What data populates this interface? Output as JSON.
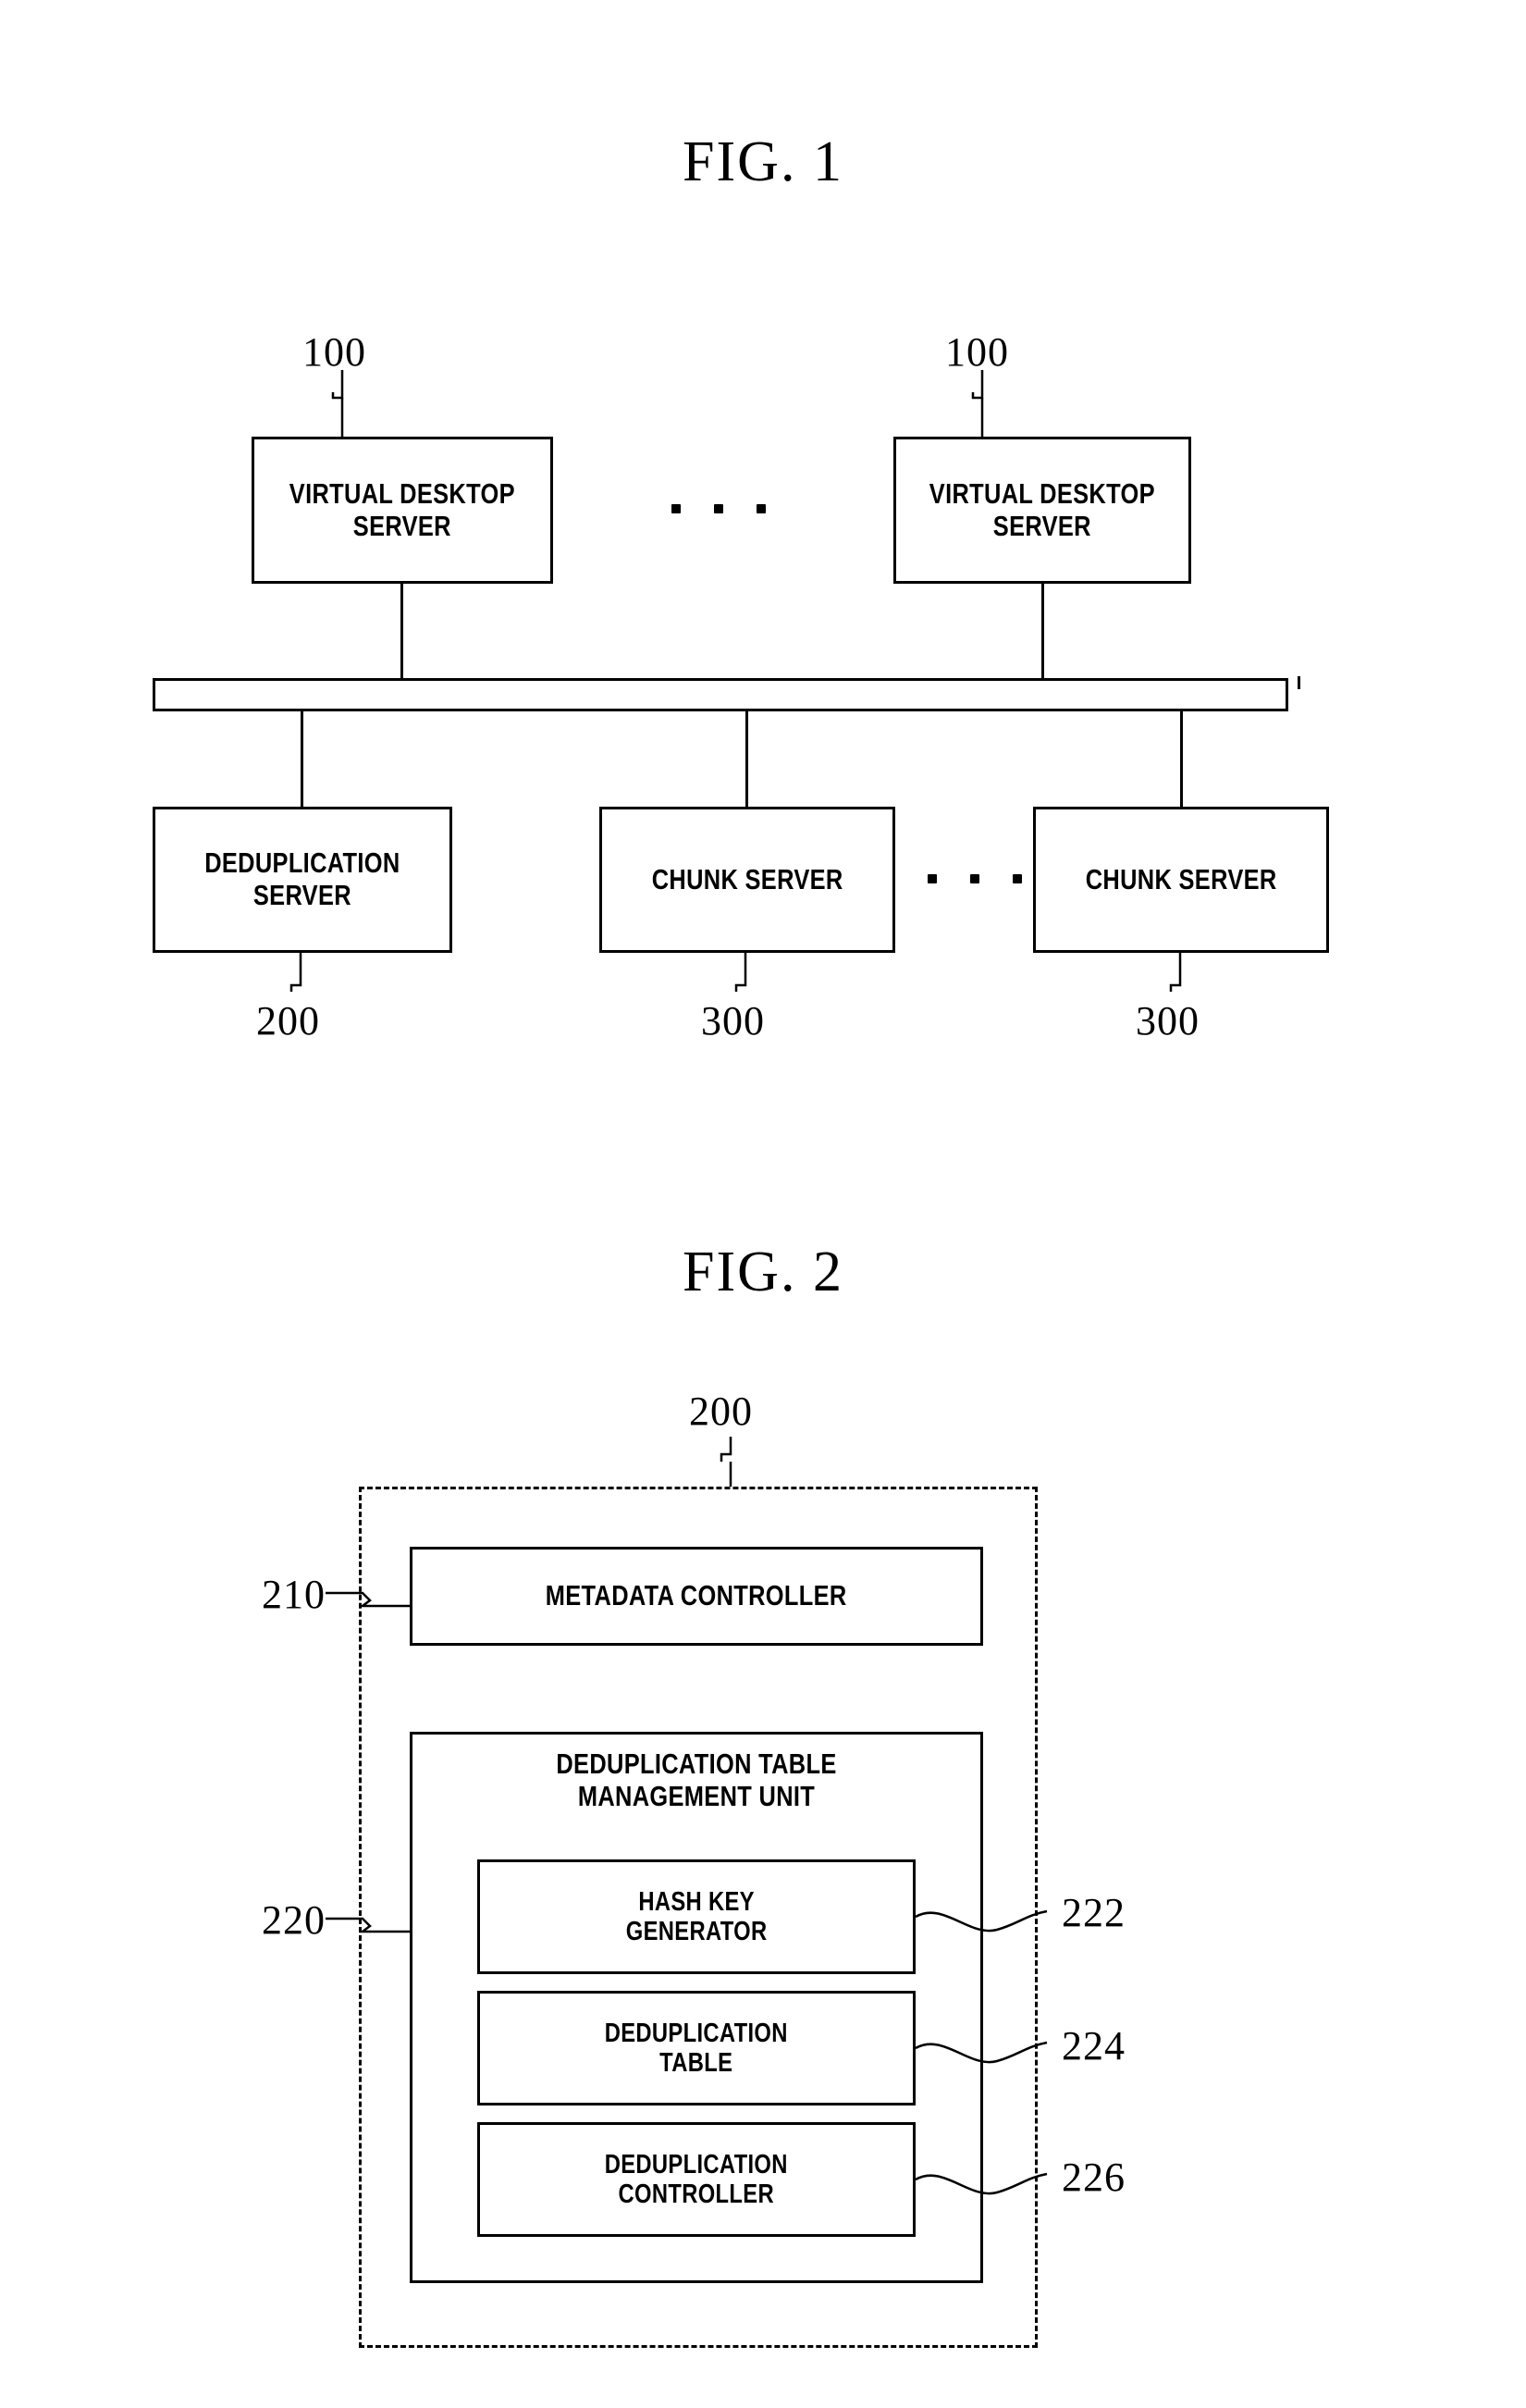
{
  "figures": [
    {
      "title": "FIG. 1",
      "nodes": [
        {
          "id": "vds_left",
          "label": "VIRTUAL DESKTOP\nSERVER",
          "ref": "100"
        },
        {
          "id": "vds_right",
          "label": "VIRTUAL DESKTOP\nSERVER",
          "ref": "100"
        },
        {
          "id": "dedup_server",
          "label": "DEDUPLICATION\nSERVER",
          "ref": "200"
        },
        {
          "id": "chunk_left",
          "label": "CHUNK SERVER",
          "ref": "300"
        },
        {
          "id": "chunk_right",
          "label": "CHUNK SERVER",
          "ref": "300"
        }
      ],
      "ellipsis_top": ". . .",
      "ellipsis_bottom": ". . ."
    },
    {
      "title": "FIG. 2",
      "enclosure_ref": "200",
      "nodes": [
        {
          "id": "metadata_controller",
          "label": "METADATA CONTROLLER",
          "ref": "210"
        },
        {
          "id": "dedup_table_unit",
          "label": "DEDUPLICATION TABLE\nMANAGEMENT UNIT",
          "ref": "220"
        },
        {
          "id": "hash_key_generator",
          "label": "HASH KEY\nGENERATOR",
          "ref": "222"
        },
        {
          "id": "dedup_table",
          "label": "DEDUPLICATION\nTABLE",
          "ref": "224"
        },
        {
          "id": "dedup_controller",
          "label": "DEDUPLICATION\nCONTROLLER",
          "ref": "226"
        }
      ]
    }
  ],
  "colors": {
    "ink": "#000000",
    "paper": "#ffffff"
  }
}
